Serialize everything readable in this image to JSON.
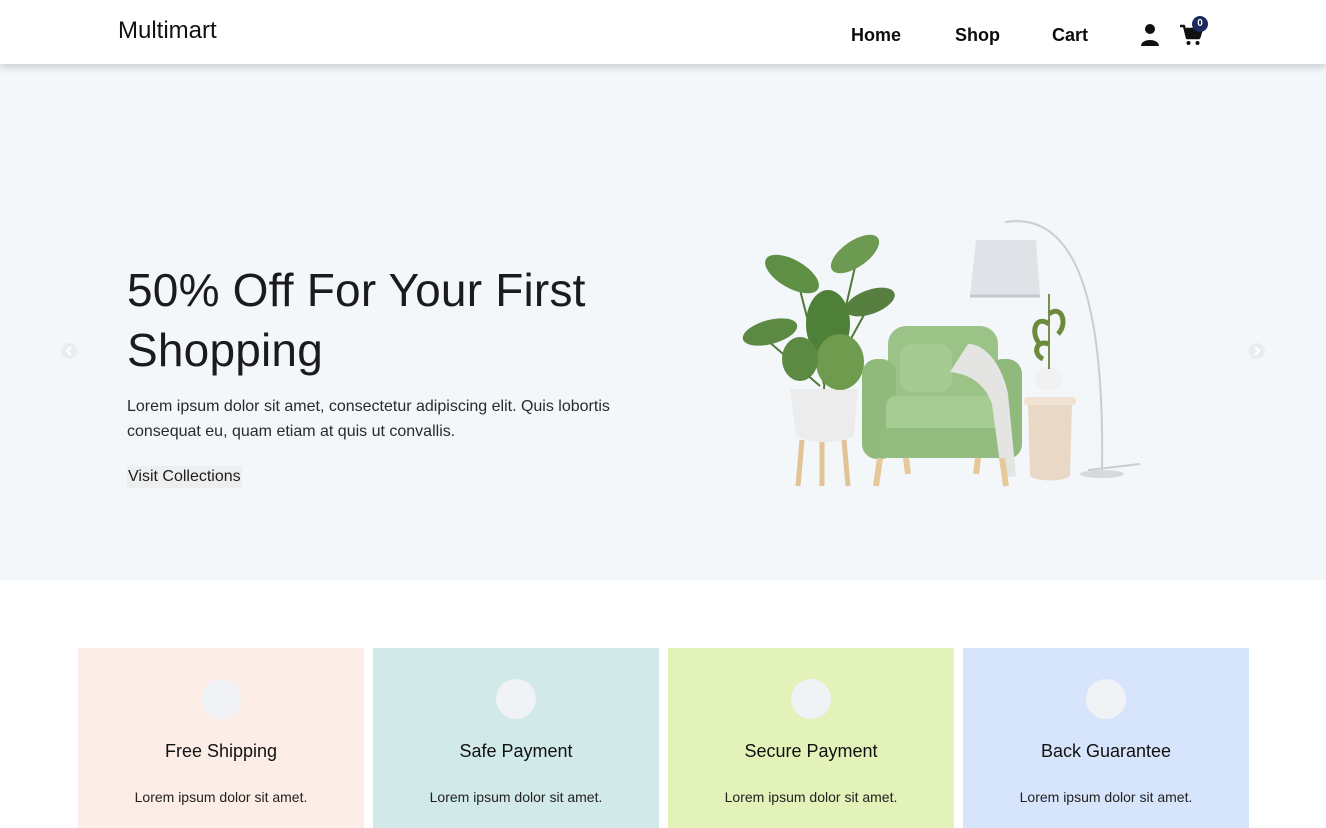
{
  "header": {
    "brand": "Multimart",
    "nav": [
      {
        "label": "Home"
      },
      {
        "label": "Shop"
      },
      {
        "label": "Cart"
      }
    ],
    "user_icon": "user-icon",
    "cart_icon": "cart-icon",
    "cart_count": "0"
  },
  "hero": {
    "title": "50% Off For Your First Shopping",
    "text": "Lorem ipsum dolor sit amet, consectetur adipiscing elit. Quis lobortis consequat eu, quam etiam at quis ut convallis.",
    "button": "Visit Collections",
    "prev_icon": "chevron-left-icon",
    "next_icon": "chevron-right-icon"
  },
  "services": [
    {
      "title": "Free Shipping",
      "text": "Lorem ipsum dolor sit amet.",
      "color": "#fceee6"
    },
    {
      "title": "Safe Payment",
      "text": "Lorem ipsum dolor sit amet.",
      "color": "#d1e9e8"
    },
    {
      "title": "Secure Payment",
      "text": "Lorem ipsum dolor sit amet.",
      "color": "#e2f2b9"
    },
    {
      "title": "Back Guarantee",
      "text": "Lorem ipsum dolor sit amet.",
      "color": "#d6e4fc"
    }
  ]
}
